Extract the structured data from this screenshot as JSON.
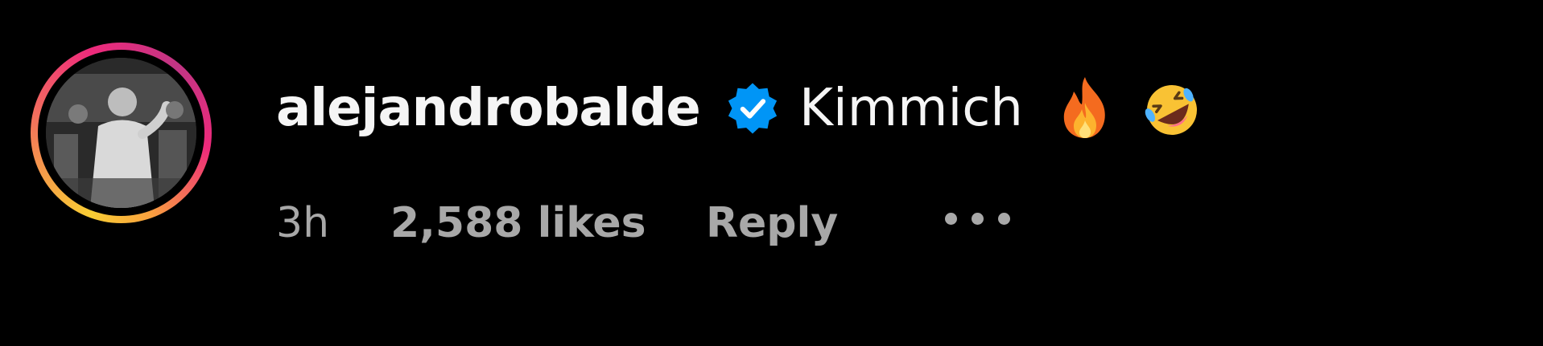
{
  "comment": {
    "username": "alejandrobalde",
    "verified": true,
    "text": "Kimmich",
    "emojis": [
      "fire-emoji",
      "rolling-on-floor-laughing-emoji"
    ],
    "time": "3h",
    "likes": "2,588 likes",
    "reply_label": "Reply",
    "more_icon": "ellipsis-icon"
  },
  "colors": {
    "background": "#000000",
    "primary_text": "#f5f5f5",
    "secondary_text": "#a8a8a8",
    "verified_blue": "#0095f6",
    "story_ring": [
      "#f9ce34",
      "#ee2a7b",
      "#c13584"
    ]
  }
}
